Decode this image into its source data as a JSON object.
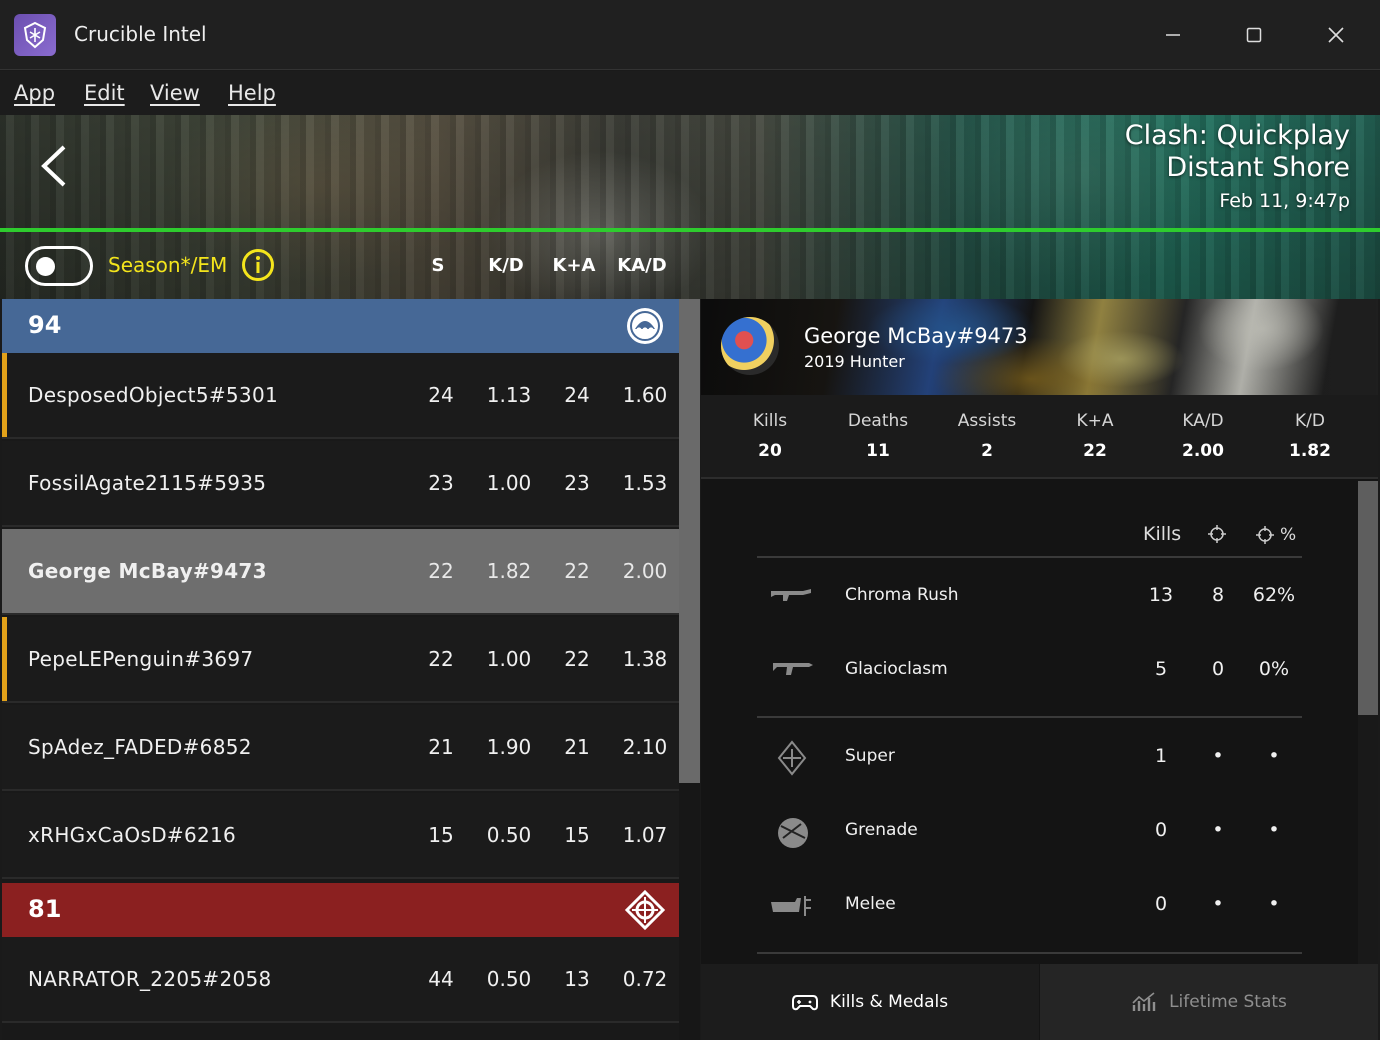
{
  "window": {
    "title": "Crucible Intel"
  },
  "menu": [
    "App",
    "Edit",
    "View",
    "Help"
  ],
  "match": {
    "mode": "Clash: Quickplay",
    "map": "Distant Shore",
    "time": "Feb 11, 9:47p"
  },
  "controls": {
    "season_label": "Season*/EM",
    "toggle_on": false,
    "columns": [
      "S",
      "K/D",
      "K+A",
      "KA/D"
    ]
  },
  "teams": [
    {
      "score": "94",
      "color": "#466896",
      "players": [
        {
          "name": "DesposedObject5#5301",
          "stats": [
            "24",
            "1.13",
            "24",
            "1.60"
          ],
          "accent": true
        },
        {
          "name": "FossilAgate2115#5935",
          "stats": [
            "23",
            "1.00",
            "23",
            "1.53"
          ],
          "accent": false
        },
        {
          "name": "George McBay#9473",
          "stats": [
            "22",
            "1.82",
            "22",
            "2.00"
          ],
          "accent": false,
          "selected": true
        },
        {
          "name": "PepeLEPenguin#3697",
          "stats": [
            "22",
            "1.00",
            "22",
            "1.38"
          ],
          "accent": true
        },
        {
          "name": "SpAdez_FADED#6852",
          "stats": [
            "21",
            "1.90",
            "21",
            "2.10"
          ],
          "accent": false
        },
        {
          "name": "xRHGxCaOsD#6216",
          "stats": [
            "15",
            "0.50",
            "15",
            "1.07"
          ],
          "accent": false
        }
      ]
    },
    {
      "score": "81",
      "color": "#8b2020",
      "players": [
        {
          "name": "NARRATOR_2205#2058",
          "stats": [
            "44",
            "0.50",
            "13",
            "0.72"
          ],
          "accent": false
        }
      ]
    }
  ],
  "selected_player": {
    "name": "George McBay#9473",
    "subtitle": "2019 Hunter",
    "summary": [
      {
        "label": "Kills",
        "value": "20"
      },
      {
        "label": "Deaths",
        "value": "11"
      },
      {
        "label": "Assists",
        "value": "2"
      },
      {
        "label": "K+A",
        "value": "22"
      },
      {
        "label": "KA/D",
        "value": "2.00"
      },
      {
        "label": "K/D",
        "value": "1.82"
      }
    ],
    "breakdown_headers": {
      "kills": "Kills",
      "precision_pct_suffix": "%"
    },
    "weapons": [
      {
        "name": "Chroma Rush",
        "kills": "13",
        "precision": "8",
        "pct": "62%",
        "icon": "auto-rifle-icon"
      },
      {
        "name": "Glacioclasm",
        "kills": "5",
        "precision": "0",
        "pct": "0%",
        "icon": "sword-icon"
      }
    ],
    "abilities": [
      {
        "name": "Super",
        "kills": "1",
        "precision": "•",
        "pct": "•",
        "icon": "super-icon"
      },
      {
        "name": "Grenade",
        "kills": "0",
        "precision": "•",
        "pct": "•",
        "icon": "grenade-icon"
      },
      {
        "name": "Melee",
        "kills": "0",
        "precision": "•",
        "pct": "•",
        "icon": "melee-icon"
      }
    ]
  },
  "tabs": {
    "kills": "Kills & Medals",
    "lifetime": "Lifetime Stats"
  }
}
